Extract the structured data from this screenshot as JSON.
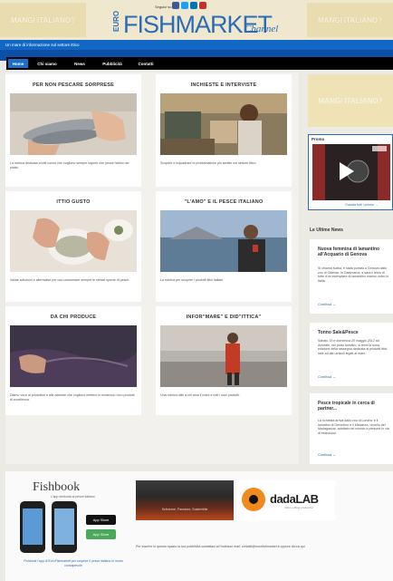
{
  "header": {
    "ad_left": "MANGI ITALIANO?",
    "ad_right": "MANGI ITALIANO?",
    "logo_euro": "EURO",
    "logo_main": "FISHMARKET",
    "logo_channel": "Channel",
    "seguici": "Seguici su",
    "social_icons": [
      "facebook-icon",
      "twitter-icon",
      "linkedin-icon",
      "youtube-icon"
    ]
  },
  "tagline": "Un mare di informazione sul settore ittico",
  "nav": {
    "items": [
      "Home",
      "Chi siamo",
      "News",
      "Pubblicità",
      "Contatti"
    ],
    "active": "Home",
    "colors": {
      "active": "#1a70c8",
      "bar": "#000000"
    }
  },
  "cards": [
    {
      "title": "PER NON PESCARE SORPRESE",
      "caption": "La rubrica dedicata a tutti coloro che vogliono sempre sapere che pesce hanno nel piatto."
    },
    {
      "title": "INCHIESTE E INTERVISTE",
      "caption": "Scoprire e inquadrare le problematiche più sentite nel settore ittico."
    },
    {
      "title": "ITTIO GUSTO",
      "caption": "Valide soluzioni e alternative per non consumare sempre le stesse specie di pesce."
    },
    {
      "title": "\"L'AMO\" E IL PESCE ITALIANO",
      "caption": "La rubrica per scoprire i prodotti ittici italiani."
    },
    {
      "title": "DA CHI PRODUCE",
      "caption": "Diamo voce ai produttori e alle aziende che vogliono mettere in evidenza i loro prodotti di eccellenza."
    },
    {
      "title": "INFOR\"MARE\" E DID\"ITTICA\"",
      "caption": "Una rubrica utile a chi ama il mare e tutti i suoi prodotti."
    }
  ],
  "sidebar": {
    "ad": "MANGI ITALIANO?",
    "promo_label": "Promo",
    "promo_link": "Guarda tutti i promo →",
    "news_heading": "Le Ultime News",
    "news": [
      {
        "title": "Nuova femmina di lamantino all'Acquario di Genova",
        "body": "Si chiama Kaiba, è stata portata a Genova dallo zoo di Odense, in Danimarca, e sarà il terzo di tutte d'un esemplare di lamantino marino unico in Italia.",
        "more": "Continua →"
      },
      {
        "title": "Tonno Sale&Pesce",
        "body": "Sabato 19 e domenica 20 maggio 2012 ad Acireale, nel porto turistico, si terrà la nona edizione della rassegna dedicata ai prodotti ittici, sale ed altri articoli legati al mare.",
        "more": "Continua →"
      },
      {
        "title": "Pesce tropicale in cerca di partner...",
        "body": "La richiesta arriva dallo zoo di Londra: è il lamatino di Geronimo e il Miniatura, uccello del Madagascar, adottato nel mondo a persone in via di estinzione.",
        "more": "Continua →"
      }
    ]
  },
  "footer": {
    "fishbook_title": "Fishbook",
    "fishbook_sub": "L'app dedicata al pesce italiano",
    "app_store": "App Store",
    "app_store_2": "App Store",
    "fishbook_caption": "Fishbook l'app di EuroFishmarket per scoprire il pesce italiano in modo consapevole",
    "banner1_text": "Selezione, Passione, Sostenibile",
    "dada_text": "dadaLAB",
    "dada_sub": "Video editing production",
    "note": "Per inserire in questo spazio la tua pubblicità contattaci al l'indirizzo mail: contatti@eurofishmarket.it oppure clicca qui"
  }
}
